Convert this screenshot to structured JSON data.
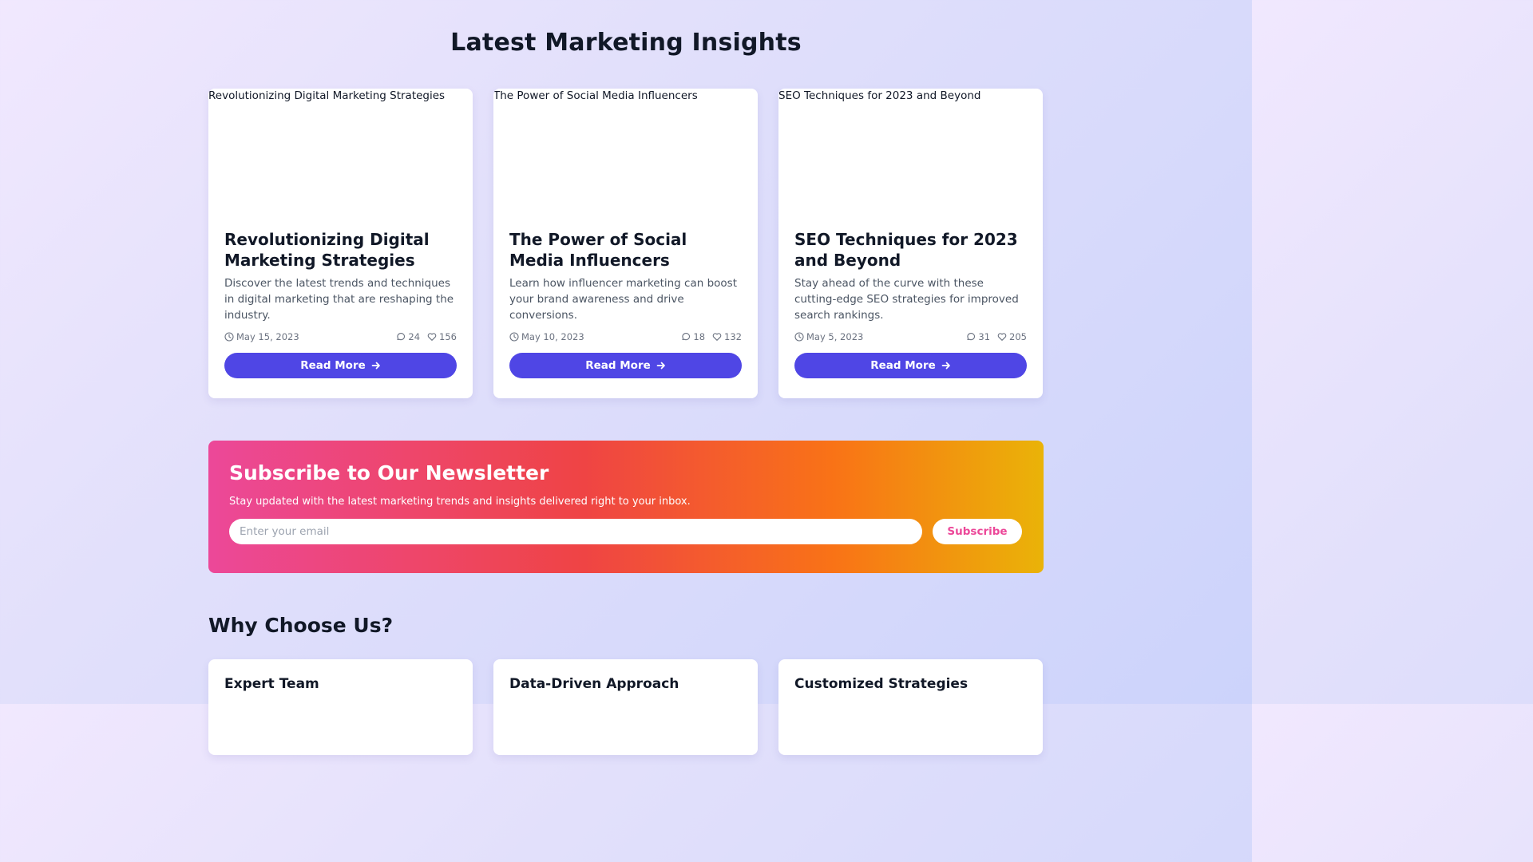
{
  "page": {
    "title": "Latest Marketing Insights"
  },
  "posts": [
    {
      "image_alt": "Revolutionizing Digital Marketing Strategies",
      "title": "Revolutionizing Digital Marketing Strategies",
      "description": "Discover the latest trends and techniques in digital marketing that are reshaping the industry.",
      "date": "May 15, 2023",
      "comments": "24",
      "likes": "156",
      "button_label": "Read More"
    },
    {
      "image_alt": "The Power of Social Media Influencers",
      "title": "The Power of Social Media Influencers",
      "description": "Learn how influencer marketing can boost your brand awareness and drive conversions.",
      "date": "May 10, 2023",
      "comments": "18",
      "likes": "132",
      "button_label": "Read More"
    },
    {
      "image_alt": "SEO Techniques for 2023 and Beyond",
      "title": "SEO Techniques for 2023 and Beyond",
      "description": "Stay ahead of the curve with these cutting-edge SEO strategies for improved search rankings.",
      "date": "May 5, 2023",
      "comments": "31",
      "likes": "205",
      "button_label": "Read More"
    }
  ],
  "icons": {
    "date": "clock-icon",
    "comments": "comment-icon",
    "likes": "heart-icon",
    "button": "arrow-right-icon"
  },
  "newsletter": {
    "title": "Subscribe to Our Newsletter",
    "text": "Stay updated with the latest marketing trends and insights delivered right to your inbox.",
    "email_placeholder": "Enter your email",
    "email_value": "",
    "button_label": "Subscribe"
  },
  "why": {
    "title": "Why Choose Us?",
    "features": [
      {
        "title": "Expert Team"
      },
      {
        "title": "Data-Driven Approach"
      },
      {
        "title": "Customized Strategies"
      }
    ]
  },
  "colors": {
    "accent": "#4f46e5",
    "newsletter_gradient": [
      "#ec4899",
      "#ef4444",
      "#f97316",
      "#eab308"
    ],
    "subscribe_text": "#ec4899"
  }
}
